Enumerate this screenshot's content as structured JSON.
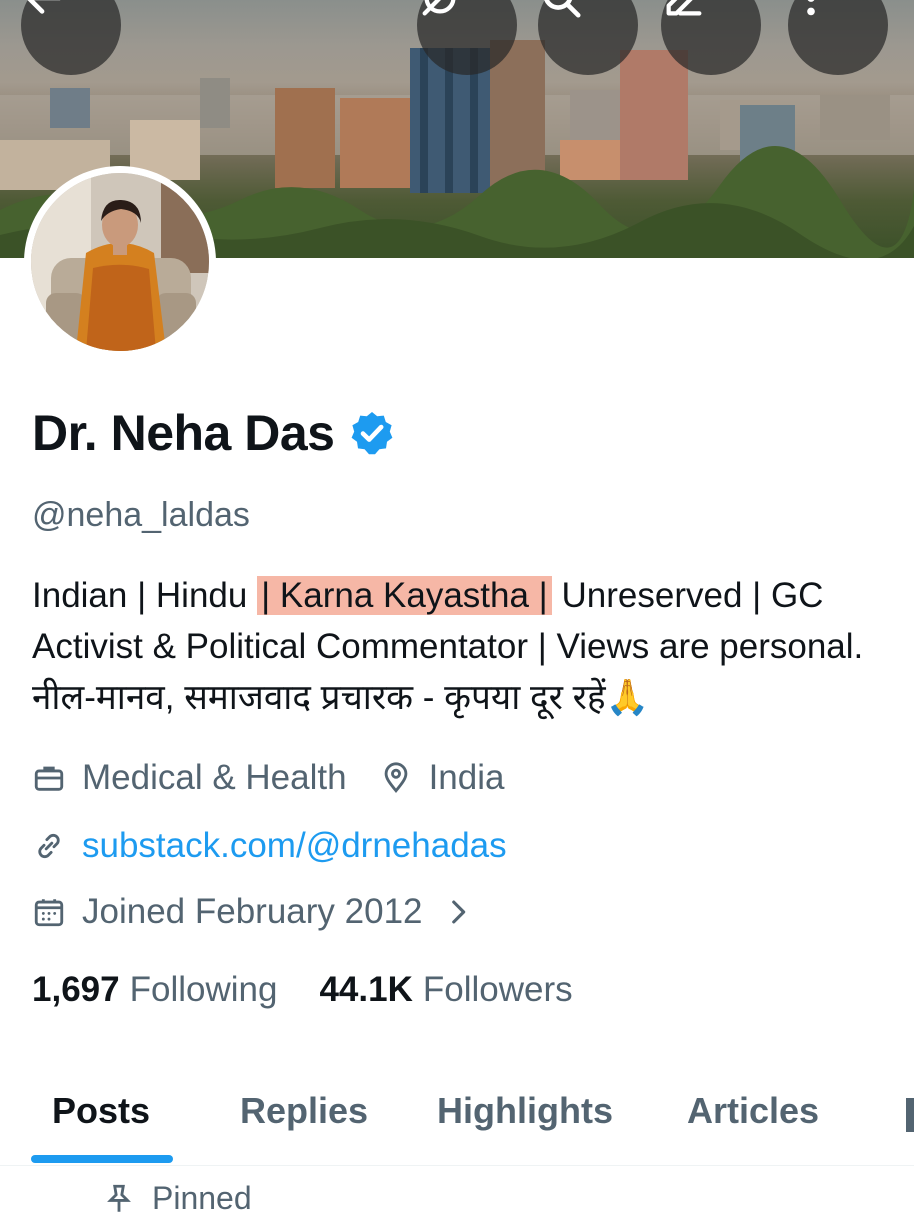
{
  "header": {
    "back_icon": "arrow-left-icon",
    "grok_icon": "grok-icon",
    "search_icon": "search-icon",
    "edit_icon": "pencil-icon",
    "more_icon": "more-vertical-icon"
  },
  "profile": {
    "name": "Dr. Neha Das",
    "verified": true,
    "handle": "@neha_laldas",
    "bio_part1": "Indian | Hindu ",
    "bio_highlight": "| Karna Kayastha |",
    "bio_part2": " Unreserved | GC Activist & Political Commentator | Views are personal. नील-मानव, समाजवाद प्रचारक - कृपया दूर रहें🙏",
    "category": "Medical & Health",
    "location": "India",
    "website": "substack.com/@drnehadas",
    "joined": "Joined February 2012"
  },
  "stats": {
    "following_count": "1,697",
    "following_label": "Following",
    "followers_count": "44.1K",
    "followers_label": "Followers"
  },
  "tabs": [
    {
      "label": "Posts",
      "active": true
    },
    {
      "label": "Replies",
      "active": false
    },
    {
      "label": "Highlights",
      "active": false
    },
    {
      "label": "Articles",
      "active": false
    }
  ],
  "pinned": {
    "label": "Pinned"
  },
  "colors": {
    "accent": "#1d9bf0",
    "text": "#0f1419",
    "secondary": "#536471",
    "highlight": "#f6b7a6"
  }
}
